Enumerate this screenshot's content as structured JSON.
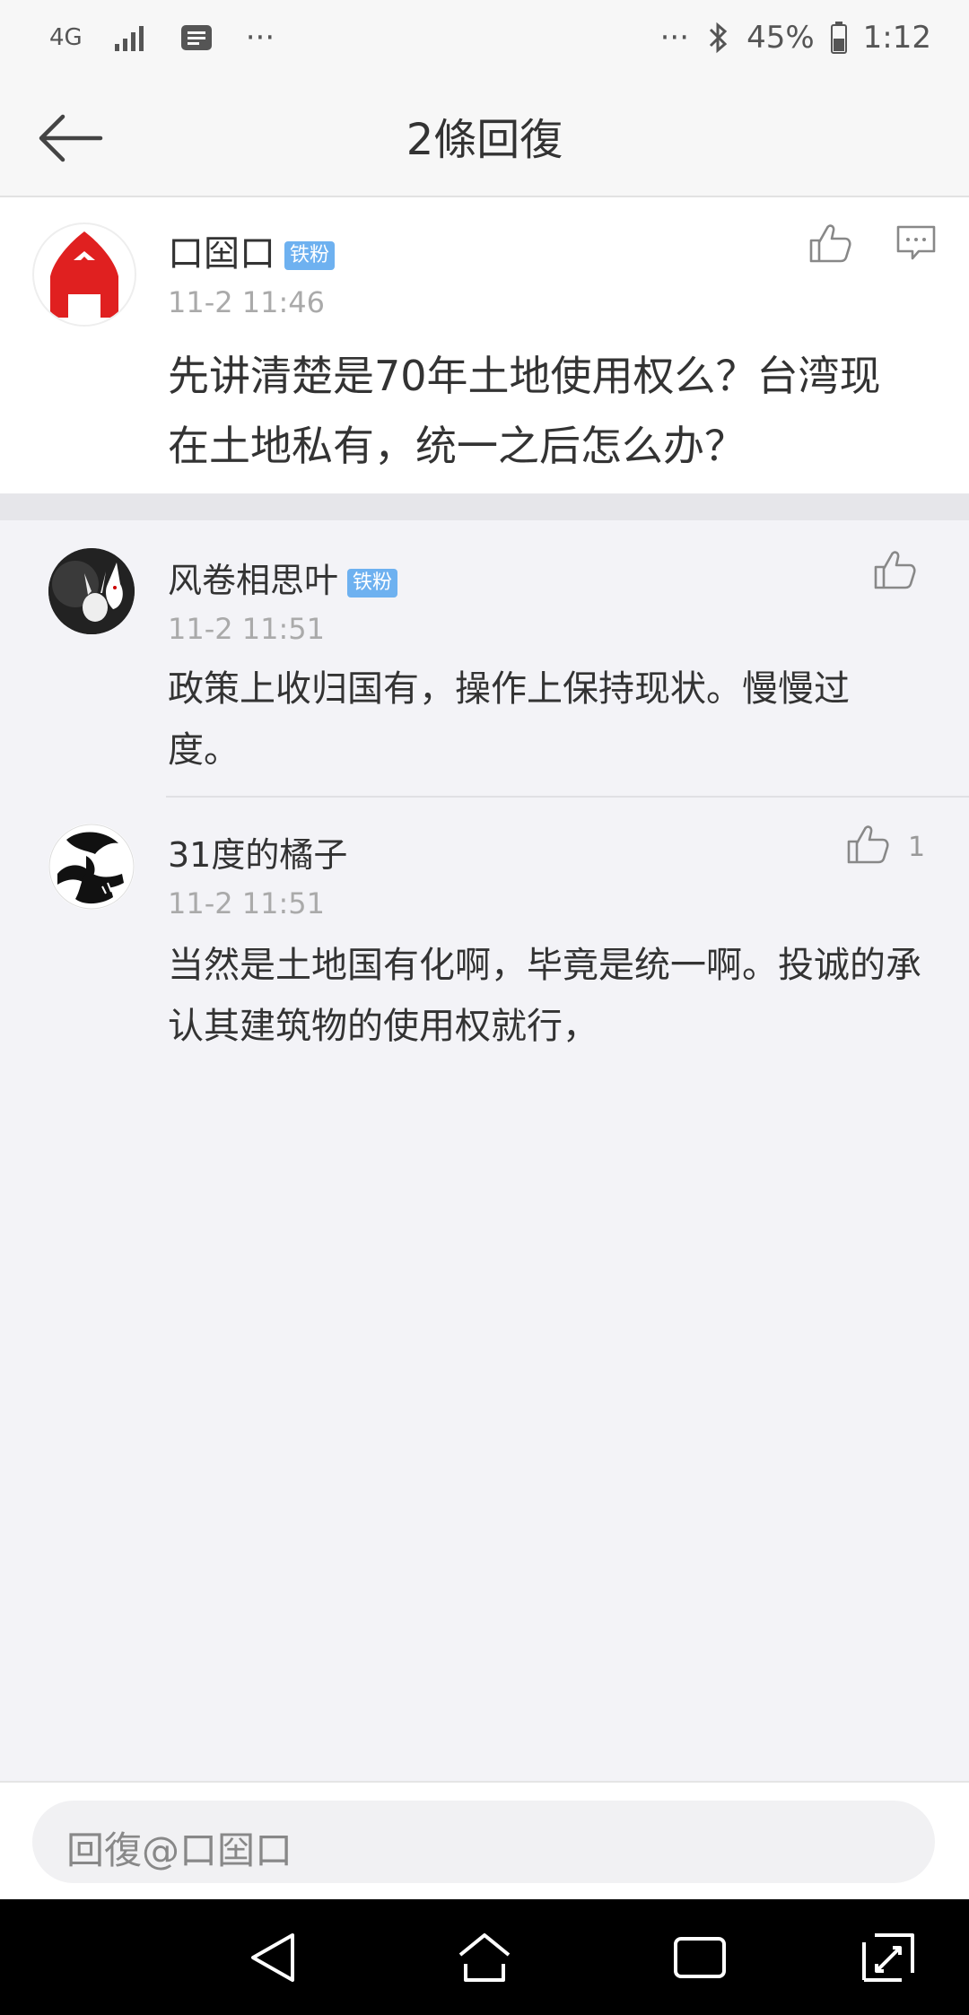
{
  "status_bar": {
    "network": "4G",
    "dots_left": "···",
    "dots_right": "···",
    "battery": "45%",
    "time": "1:12"
  },
  "header": {
    "title": "2條回復"
  },
  "main_post": {
    "username": "口囶口",
    "badge": "铁粉",
    "time": "11-2 11:46",
    "content": "先讲清楚是70年土地使用权么？台湾现在土地私有，统一之后怎么办？"
  },
  "replies": [
    {
      "username": "风卷相思叶",
      "badge": "铁粉",
      "time": "11-2 11:51",
      "content": "政策上收归国有，操作上保持现状。慢慢过度。",
      "likes": ""
    },
    {
      "username": "31度的橘子",
      "badge": "",
      "time": "11-2 11:51",
      "content": "当然是土地国有化啊，毕竟是统一啊。投诚的承认其建筑物的使用权就行，",
      "likes": "1"
    }
  ],
  "reply_bar": {
    "placeholder": "回復@口囶口"
  },
  "icons": {
    "back": "arrow-left-icon",
    "like": "thumbs-up-icon",
    "comment": "comment-icon",
    "nav": [
      "back-triangle-icon",
      "home-icon",
      "recents-icon",
      "expand-icon"
    ]
  },
  "colors": {
    "badge": "#6eb1f0",
    "avatar_red": "#e02020"
  }
}
